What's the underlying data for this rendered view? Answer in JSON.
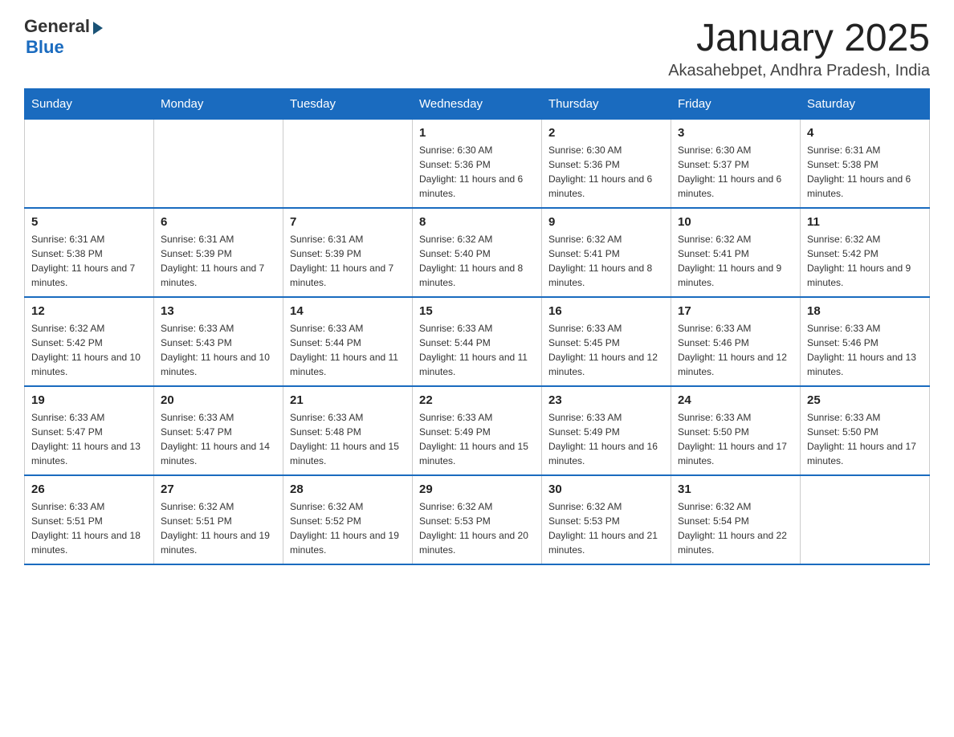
{
  "logo": {
    "general": "General",
    "blue": "Blue"
  },
  "title": "January 2025",
  "location": "Akasahebpet, Andhra Pradesh, India",
  "weekdays": [
    "Sunday",
    "Monday",
    "Tuesday",
    "Wednesday",
    "Thursday",
    "Friday",
    "Saturday"
  ],
  "weeks": [
    [
      {
        "day": "",
        "info": ""
      },
      {
        "day": "",
        "info": ""
      },
      {
        "day": "",
        "info": ""
      },
      {
        "day": "1",
        "info": "Sunrise: 6:30 AM\nSunset: 5:36 PM\nDaylight: 11 hours and 6 minutes."
      },
      {
        "day": "2",
        "info": "Sunrise: 6:30 AM\nSunset: 5:36 PM\nDaylight: 11 hours and 6 minutes."
      },
      {
        "day": "3",
        "info": "Sunrise: 6:30 AM\nSunset: 5:37 PM\nDaylight: 11 hours and 6 minutes."
      },
      {
        "day": "4",
        "info": "Sunrise: 6:31 AM\nSunset: 5:38 PM\nDaylight: 11 hours and 6 minutes."
      }
    ],
    [
      {
        "day": "5",
        "info": "Sunrise: 6:31 AM\nSunset: 5:38 PM\nDaylight: 11 hours and 7 minutes."
      },
      {
        "day": "6",
        "info": "Sunrise: 6:31 AM\nSunset: 5:39 PM\nDaylight: 11 hours and 7 minutes."
      },
      {
        "day": "7",
        "info": "Sunrise: 6:31 AM\nSunset: 5:39 PM\nDaylight: 11 hours and 7 minutes."
      },
      {
        "day": "8",
        "info": "Sunrise: 6:32 AM\nSunset: 5:40 PM\nDaylight: 11 hours and 8 minutes."
      },
      {
        "day": "9",
        "info": "Sunrise: 6:32 AM\nSunset: 5:41 PM\nDaylight: 11 hours and 8 minutes."
      },
      {
        "day": "10",
        "info": "Sunrise: 6:32 AM\nSunset: 5:41 PM\nDaylight: 11 hours and 9 minutes."
      },
      {
        "day": "11",
        "info": "Sunrise: 6:32 AM\nSunset: 5:42 PM\nDaylight: 11 hours and 9 minutes."
      }
    ],
    [
      {
        "day": "12",
        "info": "Sunrise: 6:32 AM\nSunset: 5:42 PM\nDaylight: 11 hours and 10 minutes."
      },
      {
        "day": "13",
        "info": "Sunrise: 6:33 AM\nSunset: 5:43 PM\nDaylight: 11 hours and 10 minutes."
      },
      {
        "day": "14",
        "info": "Sunrise: 6:33 AM\nSunset: 5:44 PM\nDaylight: 11 hours and 11 minutes."
      },
      {
        "day": "15",
        "info": "Sunrise: 6:33 AM\nSunset: 5:44 PM\nDaylight: 11 hours and 11 minutes."
      },
      {
        "day": "16",
        "info": "Sunrise: 6:33 AM\nSunset: 5:45 PM\nDaylight: 11 hours and 12 minutes."
      },
      {
        "day": "17",
        "info": "Sunrise: 6:33 AM\nSunset: 5:46 PM\nDaylight: 11 hours and 12 minutes."
      },
      {
        "day": "18",
        "info": "Sunrise: 6:33 AM\nSunset: 5:46 PM\nDaylight: 11 hours and 13 minutes."
      }
    ],
    [
      {
        "day": "19",
        "info": "Sunrise: 6:33 AM\nSunset: 5:47 PM\nDaylight: 11 hours and 13 minutes."
      },
      {
        "day": "20",
        "info": "Sunrise: 6:33 AM\nSunset: 5:47 PM\nDaylight: 11 hours and 14 minutes."
      },
      {
        "day": "21",
        "info": "Sunrise: 6:33 AM\nSunset: 5:48 PM\nDaylight: 11 hours and 15 minutes."
      },
      {
        "day": "22",
        "info": "Sunrise: 6:33 AM\nSunset: 5:49 PM\nDaylight: 11 hours and 15 minutes."
      },
      {
        "day": "23",
        "info": "Sunrise: 6:33 AM\nSunset: 5:49 PM\nDaylight: 11 hours and 16 minutes."
      },
      {
        "day": "24",
        "info": "Sunrise: 6:33 AM\nSunset: 5:50 PM\nDaylight: 11 hours and 17 minutes."
      },
      {
        "day": "25",
        "info": "Sunrise: 6:33 AM\nSunset: 5:50 PM\nDaylight: 11 hours and 17 minutes."
      }
    ],
    [
      {
        "day": "26",
        "info": "Sunrise: 6:33 AM\nSunset: 5:51 PM\nDaylight: 11 hours and 18 minutes."
      },
      {
        "day": "27",
        "info": "Sunrise: 6:32 AM\nSunset: 5:51 PM\nDaylight: 11 hours and 19 minutes."
      },
      {
        "day": "28",
        "info": "Sunrise: 6:32 AM\nSunset: 5:52 PM\nDaylight: 11 hours and 19 minutes."
      },
      {
        "day": "29",
        "info": "Sunrise: 6:32 AM\nSunset: 5:53 PM\nDaylight: 11 hours and 20 minutes."
      },
      {
        "day": "30",
        "info": "Sunrise: 6:32 AM\nSunset: 5:53 PM\nDaylight: 11 hours and 21 minutes."
      },
      {
        "day": "31",
        "info": "Sunrise: 6:32 AM\nSunset: 5:54 PM\nDaylight: 11 hours and 22 minutes."
      },
      {
        "day": "",
        "info": ""
      }
    ]
  ]
}
